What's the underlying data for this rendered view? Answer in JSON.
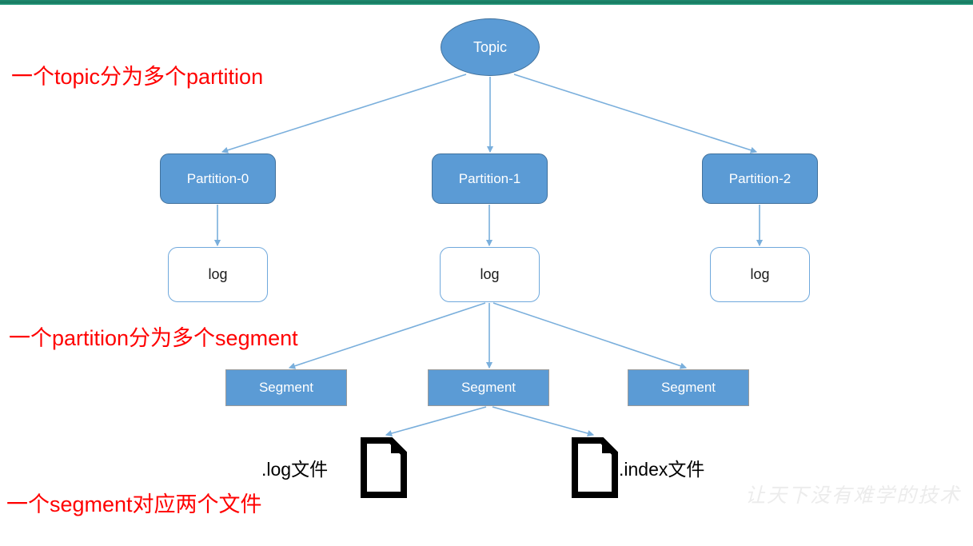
{
  "page": {
    "title": "Kafka Topic Partition Segment Structure Diagram",
    "background_color": "#ffffff",
    "topbar_color": "#1f8a70",
    "shape_fill": "#5b9bd5",
    "shape_stroke": "#41719c",
    "connector_color": "#7aafdc",
    "annotation_color": "#ff0000",
    "watermark_color": "#ececec"
  },
  "nodes": {
    "topic": {
      "label": "Topic"
    },
    "partitions": [
      {
        "label": "Partition-0"
      },
      {
        "label": "Partition-1"
      },
      {
        "label": "Partition-2"
      }
    ],
    "logs": [
      {
        "label": "log"
      },
      {
        "label": "log"
      },
      {
        "label": "log"
      }
    ],
    "segments": [
      {
        "label": "Segment"
      },
      {
        "label": "Segment"
      },
      {
        "label": "Segment"
      }
    ],
    "files": [
      {
        "label": ".log文件",
        "icon": "document-icon"
      },
      {
        "label": ".index文件",
        "icon": "document-icon"
      }
    ]
  },
  "annotations": [
    {
      "text": "一个topic分为多个partition"
    },
    {
      "text": "一个partition分为多个segment"
    },
    {
      "text": "一个segment对应两个文件"
    }
  ],
  "watermark": {
    "text": "让天下没有难学的技术"
  }
}
